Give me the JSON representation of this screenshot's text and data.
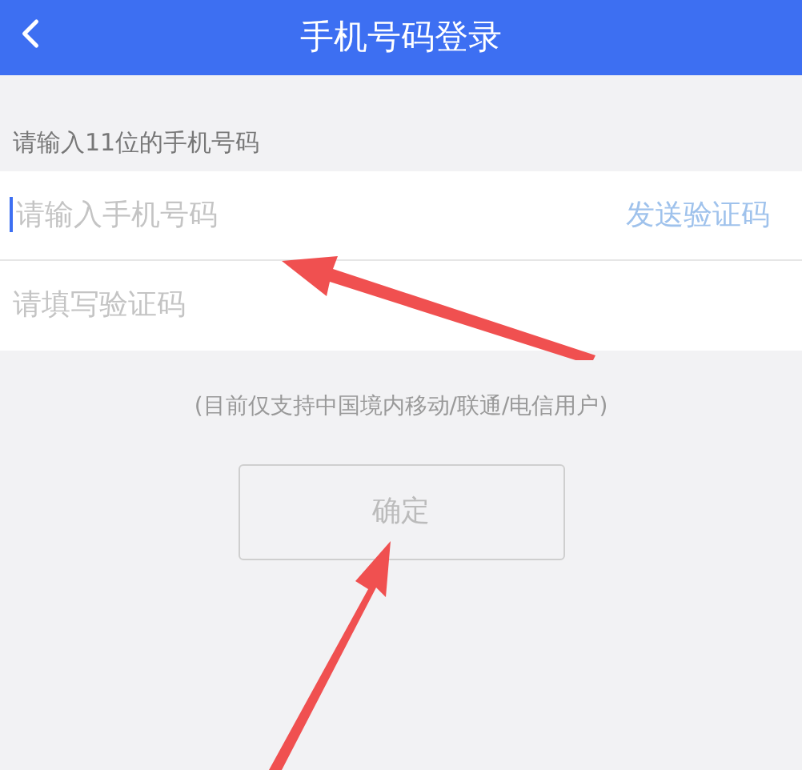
{
  "header": {
    "title": "手机号码登录"
  },
  "hint": "请输入11位的手机号码",
  "phone_field": {
    "placeholder": "请输入手机号码",
    "focused": true
  },
  "send_code": "发送验证码",
  "code_field": {
    "placeholder": "请填写验证码"
  },
  "note": "(目前仅支持中国境内移动/联通/电信用户)",
  "confirm_button": {
    "label": "确定",
    "disabled": true
  }
}
